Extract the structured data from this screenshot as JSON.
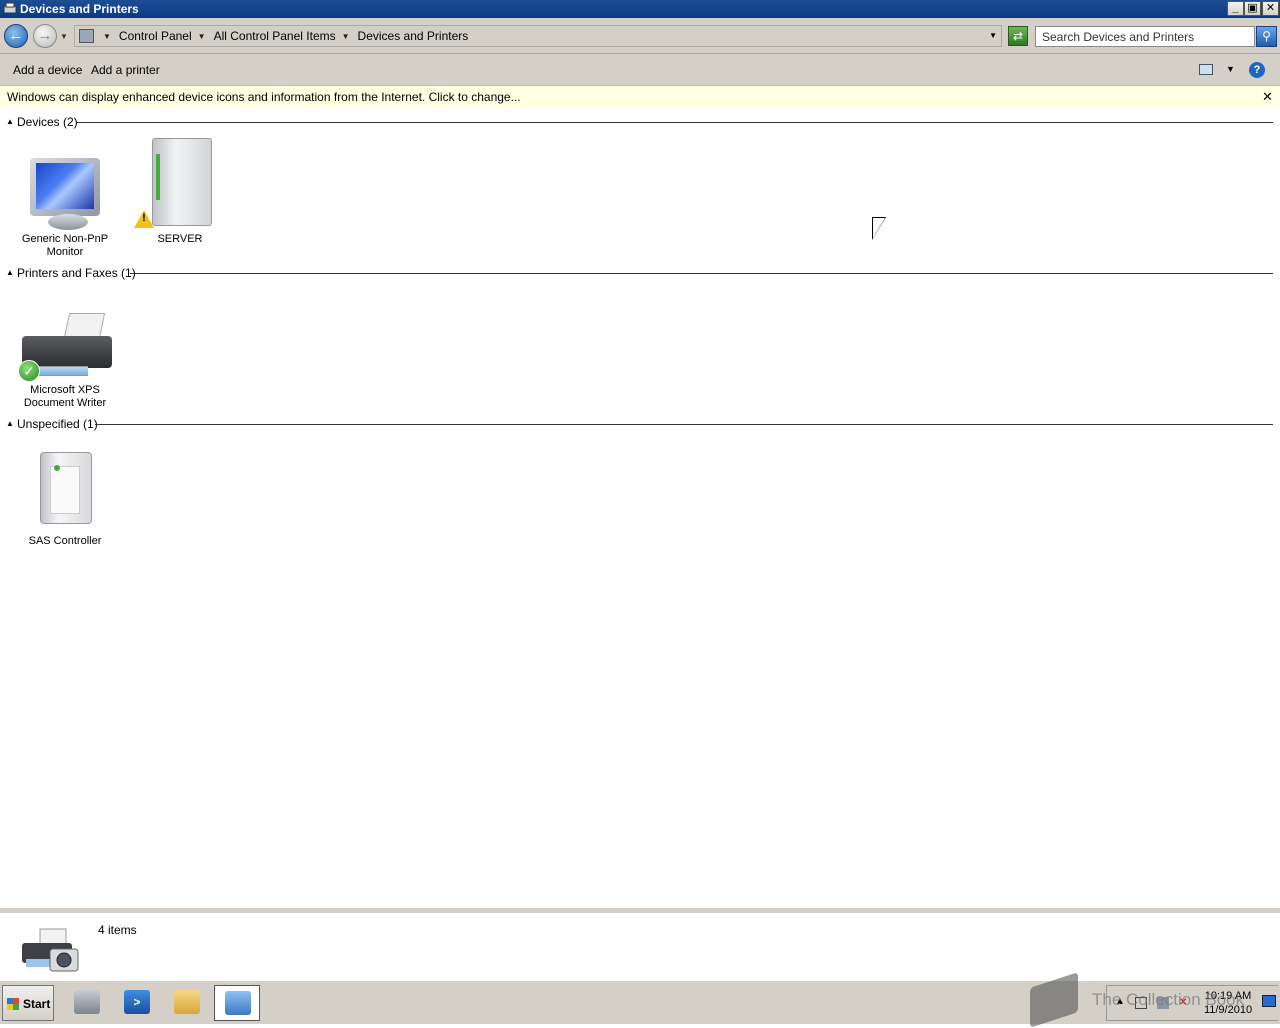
{
  "window": {
    "title": "Devices and Printers"
  },
  "address": {
    "crumbs": [
      "Control Panel",
      "All Control Panel Items",
      "Devices and Printers"
    ],
    "search_placeholder": "Search Devices and Printers"
  },
  "commands": {
    "add_device": "Add a device",
    "add_printer": "Add a printer"
  },
  "infobar": {
    "text": "Windows can display enhanced device icons and information from the Internet. Click to change..."
  },
  "groups": {
    "devices": {
      "title": "Devices (2)"
    },
    "printers": {
      "title": "Printers and Faxes (1)"
    },
    "unspecified": {
      "title": "Unspecified (1)"
    }
  },
  "items": {
    "monitor": {
      "label_line1": "Generic Non-PnP",
      "label_line2": "Monitor"
    },
    "server": {
      "label": "SERVER"
    },
    "xps": {
      "label_line1": "Microsoft XPS",
      "label_line2": "Document Writer"
    },
    "sas": {
      "label": "SAS Controller"
    }
  },
  "details": {
    "count": "4 items"
  },
  "taskbar": {
    "start": "Start",
    "time": "10:19 AM",
    "date": "11/9/2010"
  },
  "watermark": {
    "text": "The Collection Book"
  }
}
